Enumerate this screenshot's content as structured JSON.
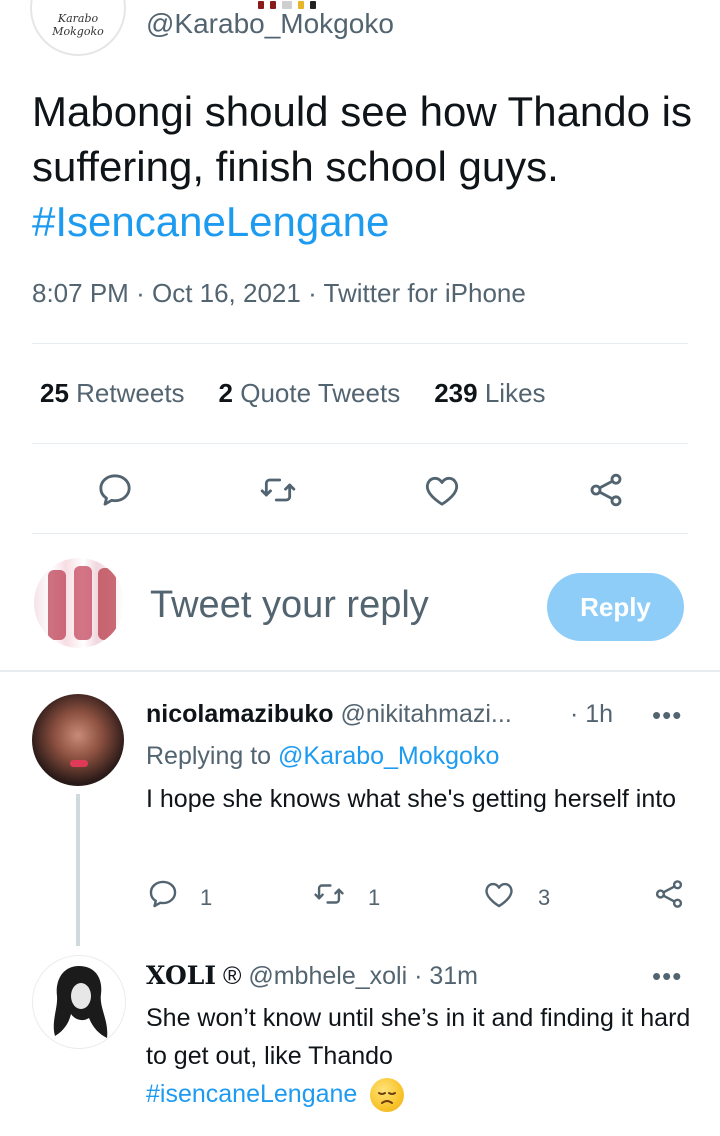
{
  "main_tweet": {
    "author_handle": "@Karabo_Mokgoko",
    "avatar_signature": "Karabo Mokgoko",
    "text": "Mabongi should see how Thando is suffering, finish school guys.",
    "hashtag": "#IsencaneLengane",
    "time": "8:07 PM",
    "date": "Oct 16, 2021",
    "source": "Twitter for iPhone",
    "retweets_count": "25",
    "retweets_label": "Retweets",
    "quotes_count": "2",
    "quotes_label": "Quote Tweets",
    "likes_count": "239",
    "likes_label": "Likes"
  },
  "composer": {
    "placeholder": "Tweet your reply",
    "reply_button": "Reply"
  },
  "replies": [
    {
      "name": "nicolamazibuko",
      "handle": "@nikitahmazi...",
      "time": "1h",
      "replying_prefix": "Replying to",
      "replying_to": "@Karabo_Mokgoko",
      "text": "I hope she knows what she's getting herself into",
      "reply_count": "1",
      "retweet_count": "1",
      "like_count": "3"
    },
    {
      "name": "XOLI",
      "name_badge": "®",
      "handle": "@mbhele_xoli",
      "time": "31m",
      "text": "She won’t know until she’s in it and finding it hard to get out, like Thando",
      "hashtag": "#isencaneLengane",
      "emoji": "disappointed-face"
    }
  ],
  "separators": {
    "dot": "·",
    "more": "•••"
  },
  "colors": {
    "accent": "#1d9bf0",
    "secondary_text": "#536471",
    "reply_button_disabled": "#8ecdf8"
  }
}
